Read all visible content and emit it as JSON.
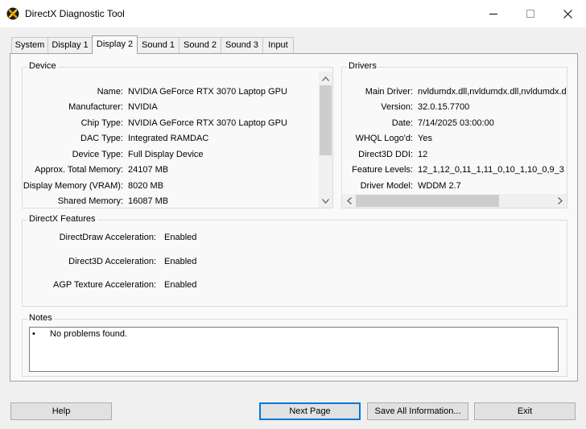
{
  "window": {
    "title": "DirectX Diagnostic Tool",
    "icon": "directx-x-icon"
  },
  "tabs": [
    {
      "label": "System"
    },
    {
      "label": "Display 1"
    },
    {
      "label": "Display 2",
      "active": true
    },
    {
      "label": "Sound 1"
    },
    {
      "label": "Sound 2"
    },
    {
      "label": "Sound 3"
    },
    {
      "label": "Input"
    }
  ],
  "device": {
    "legend": "Device",
    "rows": [
      {
        "label": "Name:",
        "value": "NVIDIA GeForce RTX 3070 Laptop GPU"
      },
      {
        "label": "Manufacturer:",
        "value": "NVIDIA"
      },
      {
        "label": "Chip Type:",
        "value": "NVIDIA GeForce RTX 3070 Laptop GPU"
      },
      {
        "label": "DAC Type:",
        "value": "Integrated RAMDAC"
      },
      {
        "label": "Device Type:",
        "value": "Full Display Device"
      },
      {
        "label": "Approx. Total Memory:",
        "value": "24107 MB"
      },
      {
        "label": "Display Memory (VRAM):",
        "value": "8020 MB"
      },
      {
        "label": "Shared Memory:",
        "value": "16087 MB"
      }
    ]
  },
  "drivers": {
    "legend": "Drivers",
    "rows": [
      {
        "label": "Main Driver:",
        "value": "nvldumdx.dll,nvldumdx.dll,nvldumdx.d"
      },
      {
        "label": "Version:",
        "value": "32.0.15.7700"
      },
      {
        "label": "Date:",
        "value": "7/14/2025 03:00:00"
      },
      {
        "label": "WHQL Logo'd:",
        "value": "Yes"
      },
      {
        "label": "Direct3D DDI:",
        "value": "12"
      },
      {
        "label": "Feature Levels:",
        "value": "12_1,12_0,11_1,11_0,10_1,10_0,9_3"
      },
      {
        "label": "Driver Model:",
        "value": "WDDM 2.7"
      }
    ]
  },
  "features": {
    "legend": "DirectX Features",
    "rows": [
      {
        "label": "DirectDraw Acceleration:",
        "value": "Enabled"
      },
      {
        "label": "Direct3D Acceleration:",
        "value": "Enabled"
      },
      {
        "label": "AGP Texture Acceleration:",
        "value": "Enabled"
      }
    ]
  },
  "notes": {
    "legend": "Notes",
    "bullet": "•",
    "text": "No problems found."
  },
  "buttons": {
    "help": "Help",
    "next_page": "Next Page",
    "save_all": "Save All Information...",
    "exit": "Exit"
  },
  "colors": {
    "default_button_border": "#0078d7",
    "panel_background": "#f9f9f9",
    "window_background": "#f0f0f0"
  }
}
